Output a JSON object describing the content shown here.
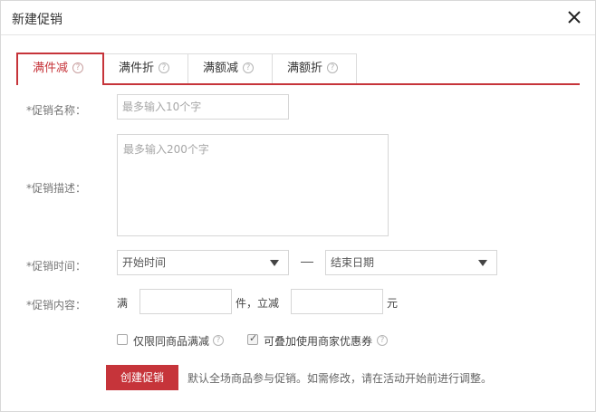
{
  "dialog": {
    "title": "新建促销"
  },
  "tabs": [
    {
      "label": "满件减",
      "help": "?"
    },
    {
      "label": "满件折",
      "help": "?"
    },
    {
      "label": "满额减",
      "help": "?"
    },
    {
      "label": "满额折",
      "help": "?"
    }
  ],
  "active_tab": "满件减",
  "form": {
    "name": {
      "label": "*促销名称：",
      "placeholder": "最多输入10个字",
      "value": ""
    },
    "description": {
      "label": "*促销描述：",
      "placeholder": "最多输入200个字",
      "value": ""
    },
    "time": {
      "label": "*促销时间：",
      "start_placeholder": "开始时间",
      "end_placeholder": "结束日期"
    },
    "content": {
      "label": "*促销内容：",
      "prefix": "满",
      "middle": "件，立减",
      "suffix": "元",
      "count_value": "",
      "amount_value": ""
    },
    "options": [
      {
        "label": "仅限同商品满减",
        "checked": false,
        "help": "?"
      },
      {
        "label": "可叠加使用商家优惠券",
        "checked": true,
        "help": "?"
      }
    ]
  },
  "actions": {
    "create_label": "创建促销",
    "hint": "默认全场商品参与促销。如需修改，请在活动开始前进行调整。"
  },
  "colors": {
    "accent": "#c6343a",
    "border": "#d6d6d6"
  }
}
